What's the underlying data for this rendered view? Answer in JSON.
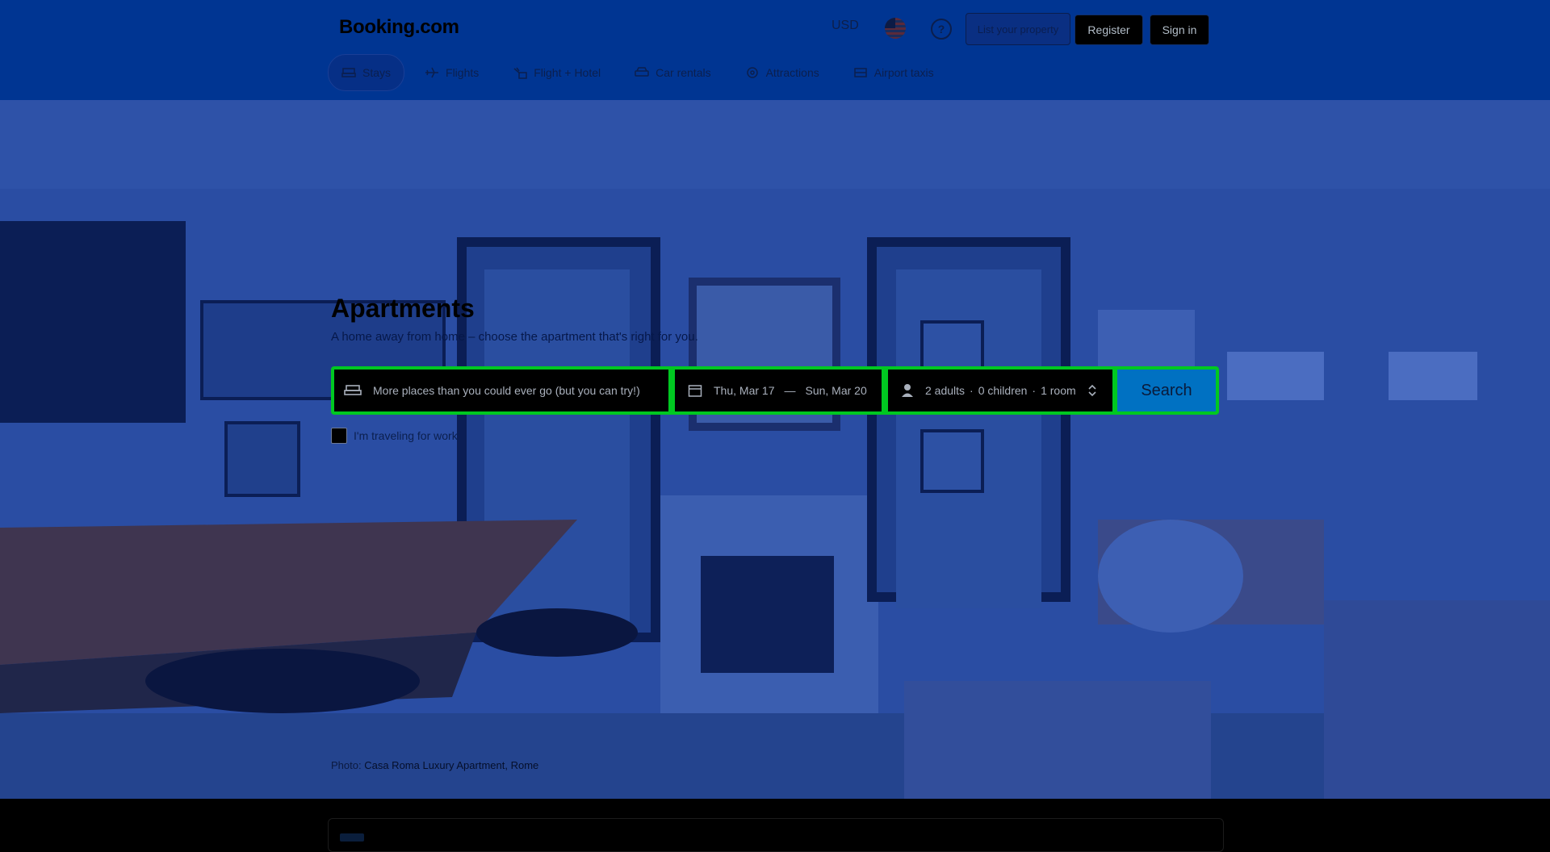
{
  "header": {
    "logo": "Booking.com",
    "currency": "USD",
    "help_symbol": "?",
    "list_property_label": "List your property",
    "register_label": "Register",
    "sign_in_label": "Sign in",
    "language_flag": "us-flag-icon"
  },
  "nav": {
    "items": [
      {
        "label": "Stays",
        "icon": "bed-icon",
        "active": true
      },
      {
        "label": "Flights",
        "icon": "plane-icon",
        "active": false
      },
      {
        "label": "Flight + Hotel",
        "icon": "flight-hotel-icon",
        "active": false
      },
      {
        "label": "Car rentals",
        "icon": "car-icon",
        "active": false
      },
      {
        "label": "Attractions",
        "icon": "attractions-icon",
        "active": false
      },
      {
        "label": "Airport taxis",
        "icon": "taxi-icon",
        "active": false
      }
    ]
  },
  "hero": {
    "title": "Apartments",
    "subtitle": "A home away from home – choose the apartment that's right for you."
  },
  "search": {
    "destination_placeholder": "More places than you could ever go (but you can try!)",
    "checkin": "Thu, Mar 17",
    "checkout": "Sun, Mar 20",
    "date_separator": "—",
    "adults": "2 adults",
    "children": "0 children",
    "rooms": "1 room",
    "occupancy_separator": "·",
    "button_label": "Search"
  },
  "work_travel": {
    "label": "I'm traveling for work"
  },
  "photo_credit": {
    "prefix": "Photo:",
    "link": "Casa Roma Luxury Apartment, Rome"
  },
  "colors": {
    "header_bg": "#003592",
    "search_border": "#00c821",
    "search_button": "#0071c2"
  }
}
